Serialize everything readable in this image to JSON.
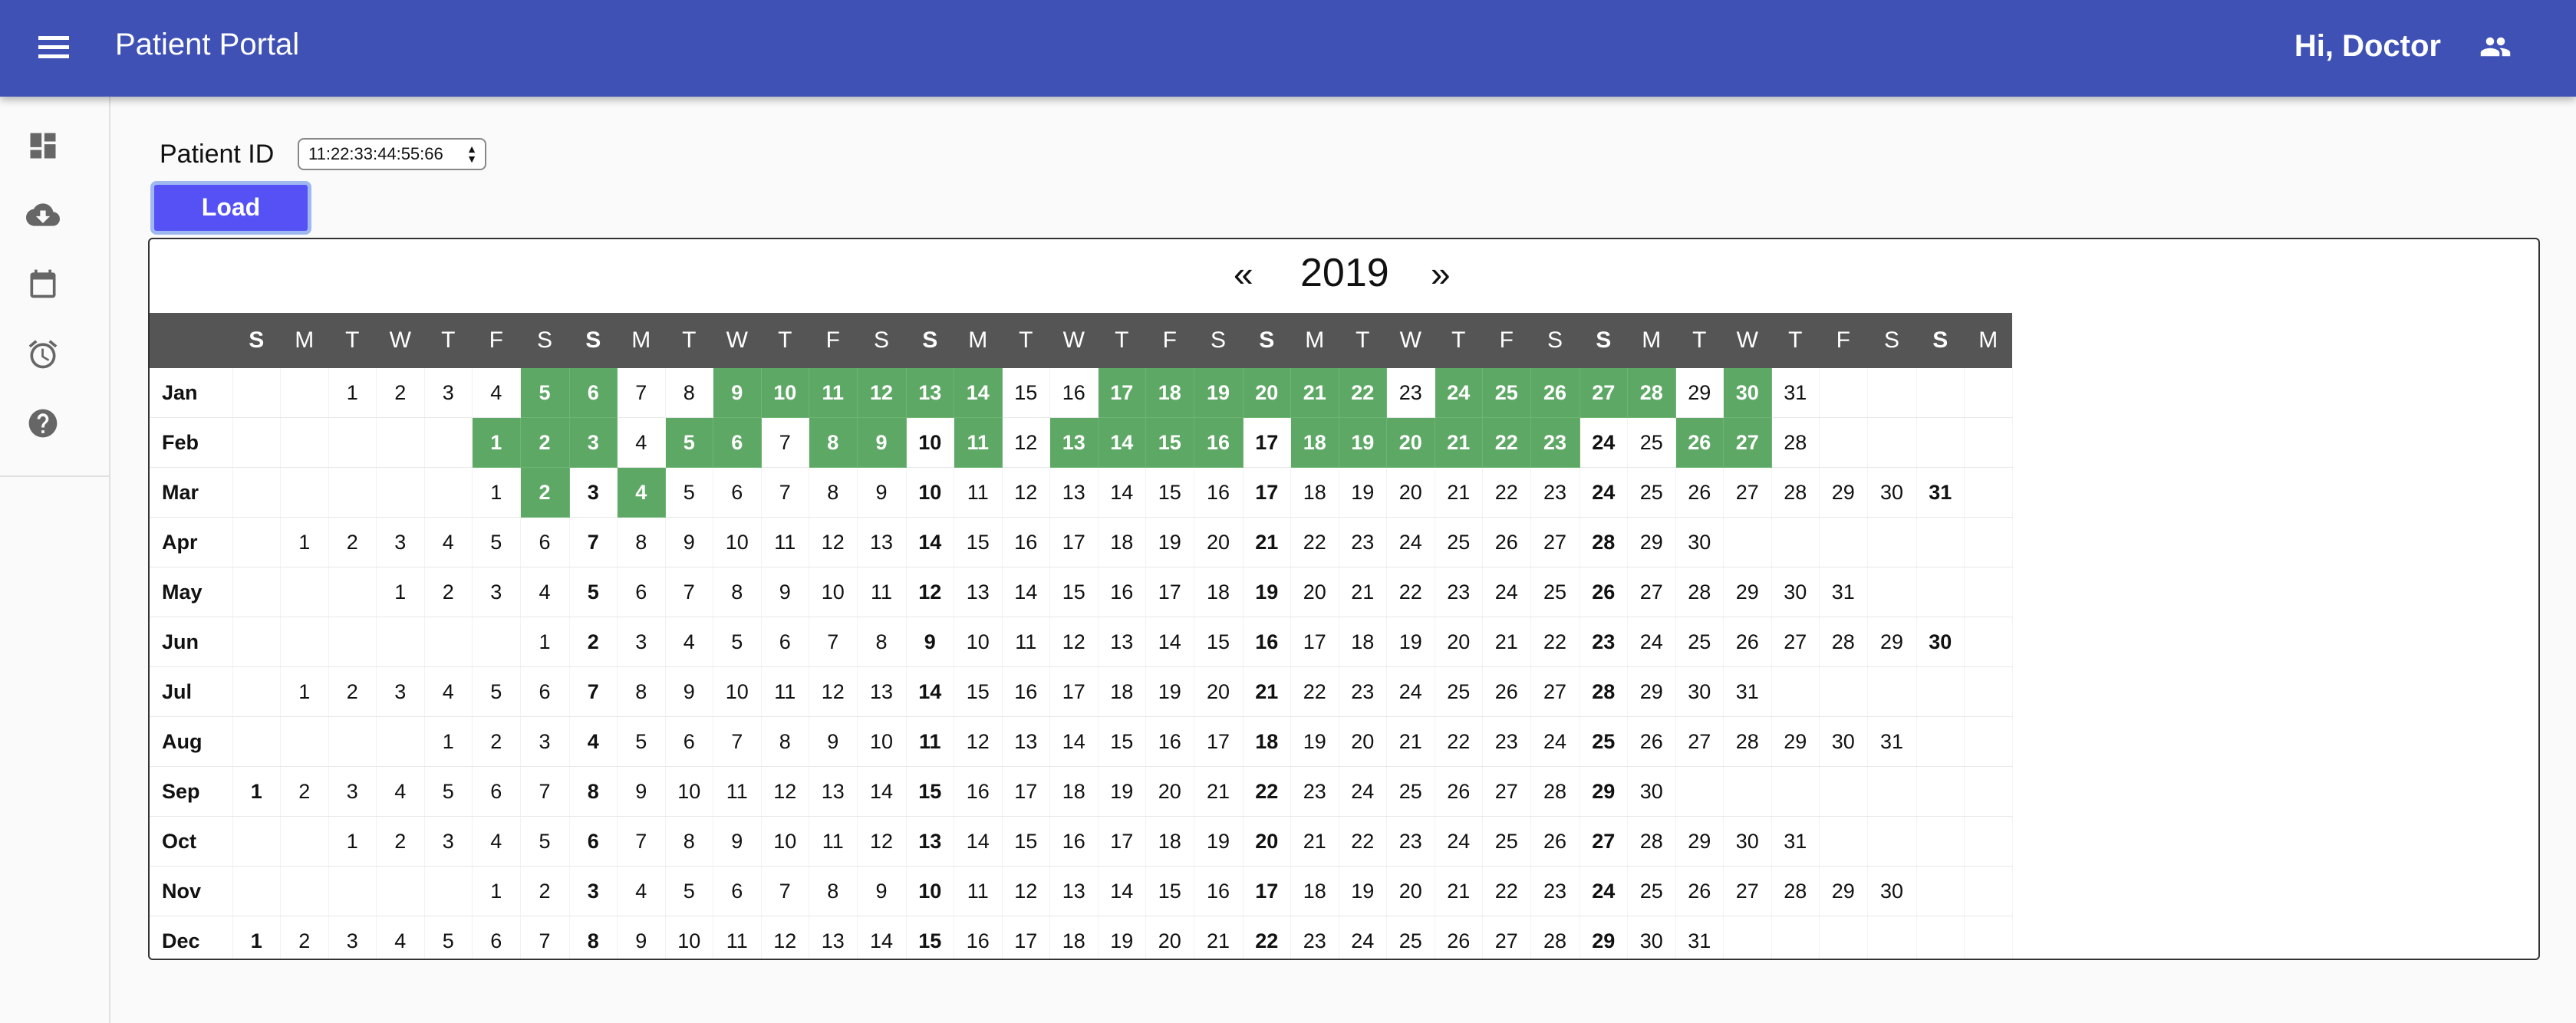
{
  "header": {
    "title": "Patient Portal",
    "greeting": "Hi, Doctor"
  },
  "sidebar": {
    "items": [
      "dashboard",
      "cloud-download",
      "calendar",
      "alarm",
      "help"
    ]
  },
  "form": {
    "patient_id_label": "Patient ID",
    "patient_id_value": "11:22:33:44:55:66",
    "load_label": "Load"
  },
  "calendar": {
    "year": "2019",
    "prev_label": "«",
    "next_label": "»",
    "weekday_headers": [
      "S",
      "M",
      "T",
      "W",
      "T",
      "F",
      "S",
      "S",
      "M",
      "T",
      "W",
      "T",
      "F",
      "S",
      "S",
      "M",
      "T",
      "W",
      "T",
      "F",
      "S",
      "S",
      "M",
      "T",
      "W",
      "T",
      "F",
      "S",
      "S",
      "M",
      "T",
      "W",
      "T",
      "F",
      "S",
      "S",
      "M"
    ],
    "months": [
      {
        "name": "Jan",
        "offset": 2,
        "days": 31,
        "highlighted": [
          5,
          6,
          9,
          10,
          11,
          12,
          13,
          14,
          17,
          18,
          19,
          20,
          21,
          22,
          24,
          25,
          26,
          27,
          28,
          30
        ]
      },
      {
        "name": "Feb",
        "offset": 5,
        "days": 28,
        "highlighted": [
          1,
          2,
          3,
          5,
          6,
          8,
          9,
          11,
          13,
          14,
          15,
          16,
          18,
          19,
          20,
          21,
          22,
          23,
          26,
          27
        ]
      },
      {
        "name": "Mar",
        "offset": 5,
        "days": 31,
        "highlighted": [
          2,
          4
        ]
      },
      {
        "name": "Apr",
        "offset": 1,
        "days": 30,
        "highlighted": []
      },
      {
        "name": "May",
        "offset": 3,
        "days": 31,
        "highlighted": []
      },
      {
        "name": "Jun",
        "offset": 6,
        "days": 30,
        "highlighted": []
      },
      {
        "name": "Jul",
        "offset": 1,
        "days": 31,
        "highlighted": []
      },
      {
        "name": "Aug",
        "offset": 4,
        "days": 31,
        "highlighted": []
      },
      {
        "name": "Sep",
        "offset": 0,
        "days": 30,
        "highlighted": []
      },
      {
        "name": "Oct",
        "offset": 2,
        "days": 31,
        "highlighted": []
      },
      {
        "name": "Nov",
        "offset": 5,
        "days": 30,
        "highlighted": []
      },
      {
        "name": "Dec",
        "offset": 0,
        "days": 31,
        "highlighted": []
      }
    ]
  },
  "colors": {
    "appbar": "#3f51b5",
    "highlight": "#5ea865",
    "header_row": "#555555",
    "load_button": "#5551f5"
  }
}
